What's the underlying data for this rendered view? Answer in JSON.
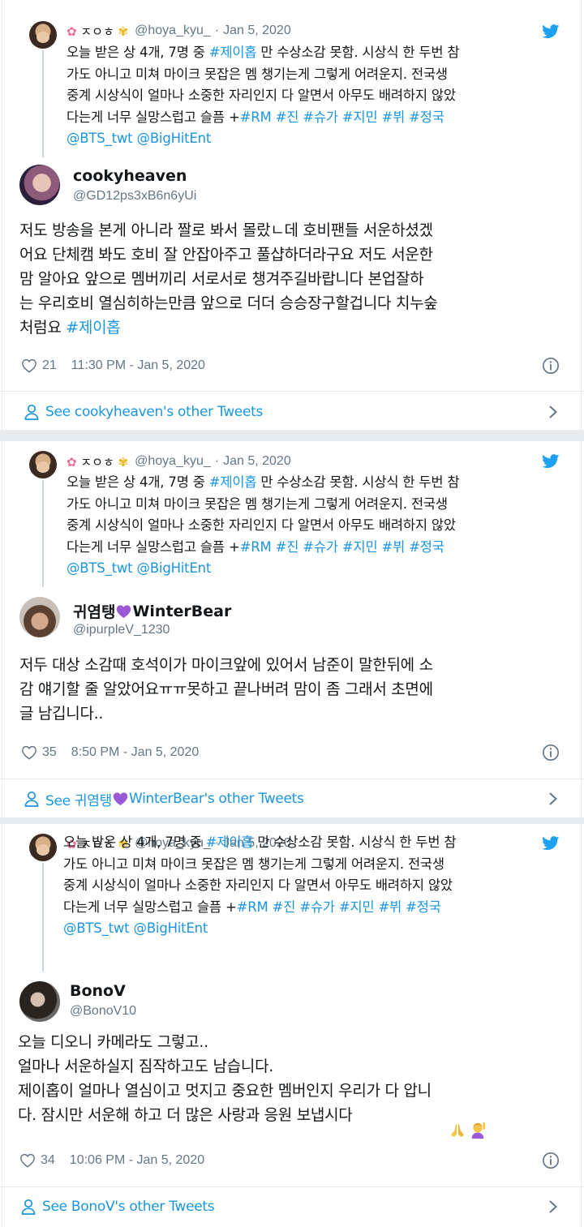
{
  "colors": {
    "link": "#1b95e0",
    "muted": "#657786",
    "text": "#14171a",
    "border": "#e6ecf0",
    "heart_emoji": "#9b59d6"
  },
  "parent_tweet": {
    "name_mid": "ㅈㅇㅎ",
    "name_icons": [
      "cherry-blossom-icon",
      "sunflower-icon"
    ],
    "handle": "@hoya_kyu_",
    "separator": "·",
    "date": "Jan 5, 2020",
    "lines": [
      [
        {
          "t": "오늘 받은 상 4개, 7명 중 "
        },
        {
          "t": "#제이홉",
          "tag": true
        },
        {
          "t": " 만 수상소감 못함. 시상식 한 두번 참"
        }
      ],
      [
        {
          "t": "가도 아니고 미쳐 마이크 못잡은 멤 챙기는게 그렇게 어려운지. 전국생"
        }
      ],
      [
        {
          "t": "중계 시상식이 얼마나 소중한 자리인지 다 알면서 아무도 배려하지 않았"
        }
      ],
      [
        {
          "t": "다는게 너무 실망스럽고 슬픔 +"
        },
        {
          "t": "#RM",
          "tag": true
        },
        {
          "t": " "
        },
        {
          "t": "#진",
          "tag": true
        },
        {
          "t": " "
        },
        {
          "t": "#슈가",
          "tag": true
        },
        {
          "t": " "
        },
        {
          "t": "#지민",
          "tag": true
        },
        {
          "t": " "
        },
        {
          "t": "#뷔",
          "tag": true
        },
        {
          "t": " "
        },
        {
          "t": "#정국",
          "tag": true
        }
      ],
      [
        {
          "t": "@BTS_twt",
          "tag": true
        },
        {
          "t": " "
        },
        {
          "t": "@BigHitEnt",
          "tag": true
        }
      ]
    ]
  },
  "replies": [
    {
      "name": "cookyheaven",
      "handle": "@GD12ps3xB6n6yUi",
      "lines": [
        [
          {
            "t": "저도 방송을 본게 아니라 짤로 봐서 몰랐ㄴ데 호비팬들 서운하셨겠"
          }
        ],
        [
          {
            "t": "어요 단체캠 봐도 호비 잘 안잡아주고 풀샵하더라구요 저도 서운한"
          }
        ],
        [
          {
            "t": "맘 알아요  앞으로 멤버끼리 서로서로 챙겨주길바랍니다  본업잘하"
          }
        ],
        [
          {
            "t": "는 우리호비 열심히하는만큼 앞으로 더더 승승장구할겁니다 치누숲"
          }
        ],
        [
          {
            "t": "처럼요 "
          },
          {
            "t": "#제이홉",
            "tag": true
          }
        ]
      ],
      "likes": "21",
      "timestamp": "11:30 PM - Jan 5, 2020",
      "see_more": "See cookyheaven's other Tweets"
    },
    {
      "name_pre": "귀염탱",
      "name_post": "WinterBear",
      "handle": "@ipurpleV_1230",
      "lines": [
        [
          {
            "t": "저두 대상 소감때 호석이가 마이크앞에 있어서 남준이 말한뒤에 소"
          }
        ],
        [
          {
            "t": "감 얘기할 줄 알았어요ㅠㅠ못하고 끝나버려 맘이 좀 그래서 초면에"
          }
        ],
        [
          {
            "t": "글 남깁니다.."
          }
        ]
      ],
      "likes": "35",
      "timestamp": "8:50 PM - Jan 5, 2020",
      "see_more_pre": "See 귀염탱",
      "see_more_post": "WinterBear's other Tweets"
    },
    {
      "name": "BonoV",
      "handle": "@BonoV10",
      "lines": [
        [
          {
            "t": "오늘 디오니 카메라도 그렇고.."
          }
        ],
        [
          {
            "t": "얼마나 서운하실지 짐작하고도 남습니다."
          }
        ],
        [
          {
            "t": "제이홉이 얼마나 열심이고 멋지고 중요한 멤버인지 우리가 다 압니"
          }
        ],
        [
          {
            "t": "다. 잠시만 서운해 하고 더 많은 사랑과 응원 보냅시다"
          }
        ]
      ],
      "trailing_icons": [
        "folded-hands-icon",
        "person-raising-hand-icon"
      ],
      "likes": "34",
      "timestamp": "10:06 PM - Jan 5, 2020",
      "see_more": "See BonoV's other Tweets"
    }
  ]
}
